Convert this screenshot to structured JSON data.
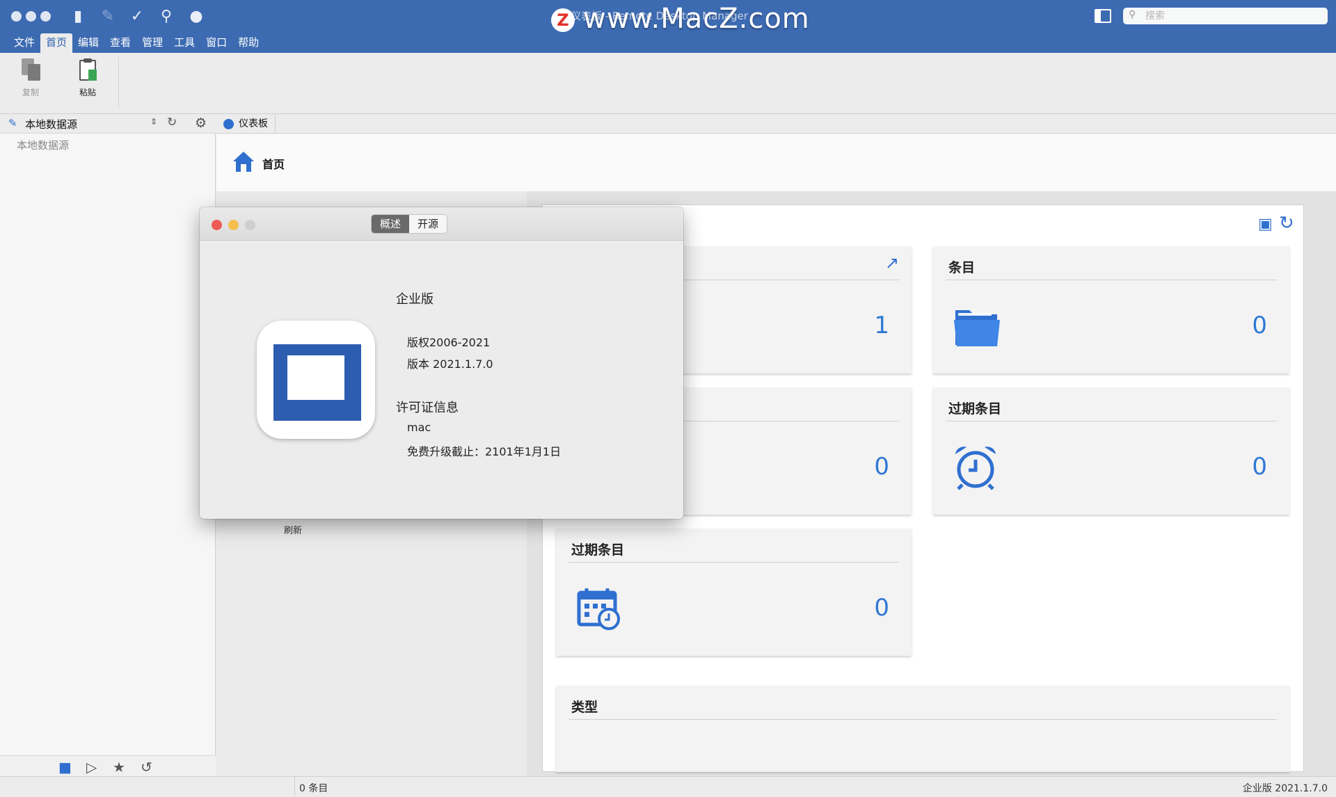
{
  "window": {
    "title": "仪表板 - Remote Desktop Manager",
    "watermark": "www.MacZ.com",
    "watermark_logo": "Z"
  },
  "toolbar_icons": [
    "new-entry-icon",
    "edit-icon",
    "batch-edit-icon",
    "find-icon",
    "lock-icon"
  ],
  "search": {
    "placeholder": "搜索",
    "value": ""
  },
  "menu": [
    {
      "label": "文件",
      "active": false
    },
    {
      "label": "首页",
      "active": true
    },
    {
      "label": "编辑",
      "active": false
    },
    {
      "label": "查看",
      "active": false
    },
    {
      "label": "管理",
      "active": false
    },
    {
      "label": "工具",
      "active": false
    },
    {
      "label": "窗口",
      "active": false
    },
    {
      "label": "帮助",
      "active": false
    }
  ],
  "ribbon": {
    "copy_label": "复制",
    "paste_label": "粘贴"
  },
  "datasource": {
    "title": "本地数据源",
    "tree_item": "本地数据源"
  },
  "tabs": {
    "dashboard": "仪表板"
  },
  "breadcrumb": {
    "home": "首页"
  },
  "left_sub": {
    "refresh": "刷新"
  },
  "cards": {
    "card1": {
      "title": "",
      "value": "1"
    },
    "entries": {
      "title": "条目",
      "value": "0"
    },
    "card3": {
      "title": "",
      "value": "0"
    },
    "expired_entries": {
      "title": "过期条目",
      "value": "0"
    },
    "expired_entries_2": {
      "title": "过期条目",
      "value": "0"
    },
    "types": {
      "title": "类型"
    }
  },
  "status": {
    "left": "0 条目",
    "right": "企业版 2021.1.7.0"
  },
  "about": {
    "tabs": [
      "概述",
      "开源"
    ],
    "edition": "企业版",
    "copyright": "版权2006-2021",
    "version": "版本 2021.1.7.0",
    "license_heading": "许可证信息",
    "licensee": "mac",
    "upgrade_until": "免费升级截止：2101年1月1日"
  },
  "colors": {
    "titlebar": "#3d6bb2",
    "accent": "#2f78d4",
    "close": "#ee5b55",
    "minimize": "#f4bf4f"
  }
}
